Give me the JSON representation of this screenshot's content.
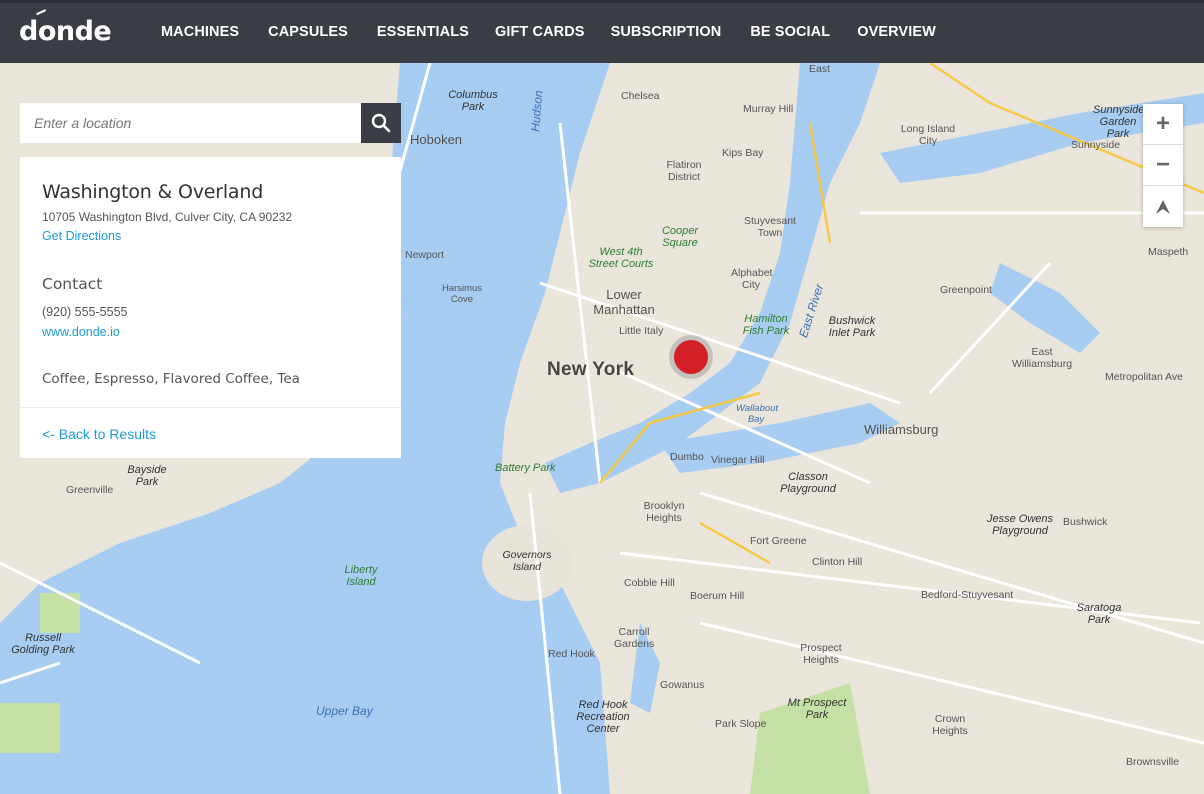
{
  "brand": {
    "logo_text": "donde"
  },
  "nav": {
    "items": [
      "MACHINES",
      "CAPSULES",
      "ESSENTIALS",
      "GIFT CARDS",
      "SUBSCRIPTION",
      "BE SOCIAL",
      "OVERVIEW"
    ]
  },
  "search": {
    "placeholder": "Enter a location",
    "button_icon": "search-icon"
  },
  "location": {
    "name": "Washington & Overland",
    "address": "10705 Washington Blvd, Culver City, CA 90232",
    "directions_label": "Get Directions",
    "contact_heading": "Contact",
    "phone": "(920) 555-5555",
    "website": "www.donde.io",
    "tags": "Coffee, Espresso, Flavored Coffee, Tea",
    "back_label": "<- Back to Results"
  },
  "zoom": {
    "in": "+",
    "out": "−",
    "compass_icon": "compass-icon"
  },
  "map_labels": {
    "new_york": "New York",
    "hoboken": "Hoboken",
    "lower_manhattan": "Lower Manhattan",
    "williamsburg": "Williamsburg",
    "battery_park": "Battery Park",
    "governors_island": "Governors Island",
    "liberty_island": "Liberty Island",
    "upper_bay": "Upper Bay",
    "red_hook": "Red Hook",
    "east_river": "East River",
    "hudson": "Hudson",
    "chelsea": "Chelsea",
    "murray_hill": "Murray Hill",
    "kips_bay": "Kips Bay",
    "flatiron": "Flatiron District",
    "west_4th": "West 4th Street Courts",
    "cooper_square": "Cooper Square",
    "alphabet_city": "Alphabet City",
    "little_italy": "Little Italy",
    "hamilton_fish": "Hamilton Fish Park",
    "dumbo": "Dumbo",
    "vinegar_hill": "Vinegar Hill",
    "brooklyn_heights": "Brooklyn Heights",
    "cobble_hill": "Cobble Hill",
    "boerum_hill": "Boerum Hill",
    "fort_greene": "Fort Greene",
    "clinton_hill": "Clinton Hill",
    "bedford_stuyvesant": "Bedford-Stuyvesant",
    "carroll_gardens": "Carroll Gardens",
    "gowanus": "Gowanus",
    "park_slope": "Park Slope",
    "prospect_heights": "Prospect Heights",
    "mt_prospect": "Mt Prospect Park",
    "crown_heights": "Crown Heights",
    "greenpoint": "Greenpoint",
    "east_williamsburg": "East Williamsburg",
    "bushwick_inlet": "Bushwick Inlet Park",
    "long_island_city": "Long Island City",
    "sunnyside": "Sunnyside",
    "maspeth": "Maspeth",
    "bushwick": "Bushwick",
    "jesse_owens": "Jesse Owens Playground",
    "saratoga": "Saratoga Park",
    "classon": "Classon Playground",
    "bayside_park": "Bayside Park",
    "greenville": "Greenville",
    "russell_golding": "Russell Golding Park",
    "columbus_park": "Columbus Park",
    "red_hook_rec": "Red Hook Recreation Center",
    "brownsville": "Brownsville",
    "east_ny": "East",
    "newport": "Newport",
    "harsimus": "Harsimus Cove",
    "stuyvesant": "Stuyvesant Town",
    "wallabout": "Wallabout Bay",
    "metropolitan": "Metropolitan Ave",
    "sunnyside_gardens": "Sunnyside Garden Park"
  }
}
